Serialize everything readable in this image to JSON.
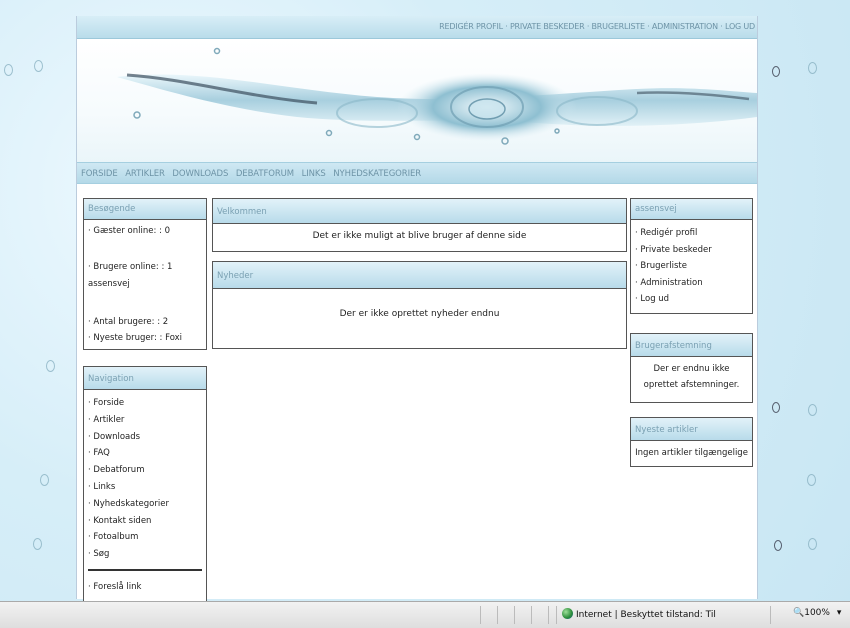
{
  "top_links": [
    "REDIGÉR PROFIL",
    "PRIVATE BESKEDER",
    "BRUGERLISTE",
    "ADMINISTRATION",
    "LOG UD"
  ],
  "top_sep": " · ",
  "main_nav": [
    "FORSIDE",
    "ARTIKLER",
    "DOWNLOADS",
    "DEBATFORUM",
    "LINKS",
    "NYHEDSKATEGORIER"
  ],
  "bullet": "·",
  "visitors": {
    "title": "Besøgende",
    "guests_label": "Gæster online: :",
    "guests_count": "0",
    "users_label": "Brugere online: :",
    "users_count": "1",
    "users_online_name": "assensvej",
    "total_label": "Antal brugere: :",
    "total_count": "2",
    "newest_label": "Nyeste bruger: :",
    "newest_name": "Foxi"
  },
  "navigation": {
    "title": "Navigation",
    "items": [
      "Forside",
      "Artikler",
      "Downloads",
      "FAQ",
      "Debatforum",
      "Links",
      "Nyhedskategorier",
      "Kontakt siden",
      "Fotoalbum",
      "Søg"
    ],
    "extra": "Foreslå link"
  },
  "welcome": {
    "title": "Velkommen",
    "text": "Det er ikke muligt at blive bruger af denne side"
  },
  "news": {
    "title": "Nyheder",
    "text": "Der er ikke oprettet nyheder endnu"
  },
  "user_panel": {
    "title": "assensvej",
    "items": [
      "Redigér profil",
      "Private beskeder",
      "Brugerliste",
      "Administration",
      "Log ud"
    ]
  },
  "poll": {
    "title": "Brugerafstemning",
    "text": "Der er endnu ikke oprettet afstemninger."
  },
  "latest_articles": {
    "title": "Nyeste artikler",
    "text": "Ingen artikler tilgængelige"
  },
  "statusbar": {
    "zone_text": "Internet | Beskyttet tilstand: Til",
    "zoom": "100%",
    "dropdown_arrow": "▾"
  }
}
